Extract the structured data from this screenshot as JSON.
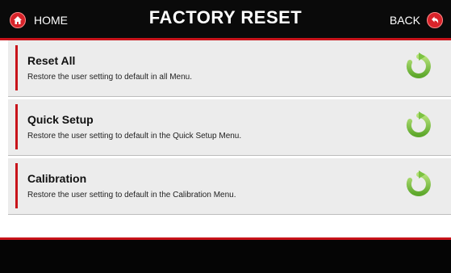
{
  "header": {
    "title": "FACTORY RESET",
    "home_label": "HOME",
    "back_label": "BACK",
    "home_icon": "home-icon",
    "back_icon": "back-arrow-icon"
  },
  "items": [
    {
      "title": "Reset All",
      "description": "Restore the user setting to default in all Menu.",
      "icon": "reset-arrow-icon"
    },
    {
      "title": "Quick Setup",
      "description": "Restore the user setting to default in the Quick Setup Menu.",
      "icon": "reset-arrow-icon"
    },
    {
      "title": "Calibration",
      "description": "Restore the user setting to default in the Calibration Menu.",
      "icon": "reset-arrow-icon"
    }
  ],
  "colors": {
    "accent_red": "#c8131a",
    "header_bg": "#0a0a0a",
    "row_bg": "#ececec",
    "reset_green": "#7cc242"
  }
}
